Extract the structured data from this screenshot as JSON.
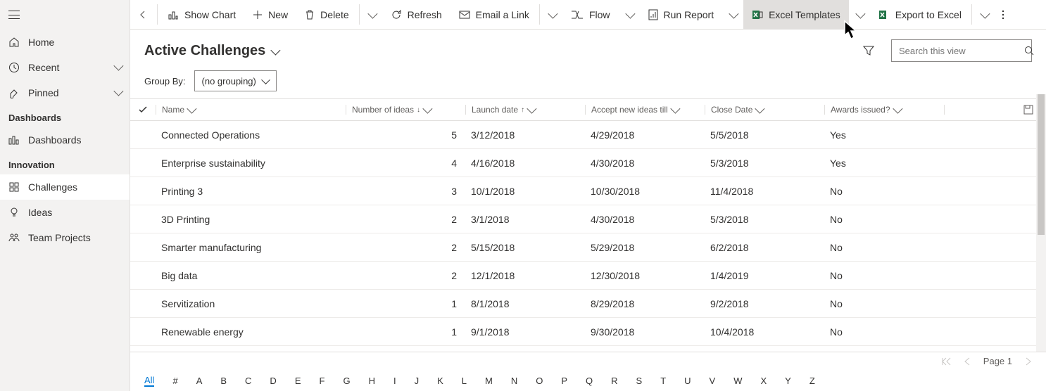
{
  "sidebar": {
    "home": "Home",
    "recent": "Recent",
    "pinned": "Pinned",
    "section_dashboards": "Dashboards",
    "dashboards_item": "Dashboards",
    "section_innovation": "Innovation",
    "challenges": "Challenges",
    "ideas": "Ideas",
    "team_projects": "Team Projects"
  },
  "toolbar": {
    "show_chart": "Show Chart",
    "new": "New",
    "delete": "Delete",
    "refresh": "Refresh",
    "email_link": "Email a Link",
    "flow": "Flow",
    "run_report": "Run Report",
    "excel_templates": "Excel Templates",
    "export_excel": "Export to Excel"
  },
  "view": {
    "title": "Active Challenges",
    "group_by_label": "Group By:",
    "group_by_value": "(no grouping)",
    "search_placeholder": "Search this view"
  },
  "grid": {
    "columns": {
      "name": "Name",
      "number_of_ideas": "Number of ideas",
      "launch_date": "Launch date",
      "accept_until": "Accept new ideas till",
      "close_date": "Close Date",
      "awards_issued": "Awards issued?"
    },
    "rows": [
      {
        "name": "Connected Operations",
        "ideas": "5",
        "launch": "3/12/2018",
        "accept": "4/29/2018",
        "close": "5/5/2018",
        "awards": "Yes"
      },
      {
        "name": "Enterprise sustainability",
        "ideas": "4",
        "launch": "4/16/2018",
        "accept": "4/30/2018",
        "close": "5/3/2018",
        "awards": "Yes"
      },
      {
        "name": "Printing 3",
        "ideas": "3",
        "launch": "10/1/2018",
        "accept": "10/30/2018",
        "close": "11/4/2018",
        "awards": "No"
      },
      {
        "name": "3D Printing",
        "ideas": "2",
        "launch": "3/1/2018",
        "accept": "4/30/2018",
        "close": "5/3/2018",
        "awards": "No"
      },
      {
        "name": "Smarter manufacturing",
        "ideas": "2",
        "launch": "5/15/2018",
        "accept": "5/29/2018",
        "close": "6/2/2018",
        "awards": "No"
      },
      {
        "name": "Big data",
        "ideas": "2",
        "launch": "12/1/2018",
        "accept": "12/30/2018",
        "close": "1/4/2019",
        "awards": "No"
      },
      {
        "name": "Servitization",
        "ideas": "1",
        "launch": "8/1/2018",
        "accept": "8/29/2018",
        "close": "9/2/2018",
        "awards": "No"
      },
      {
        "name": "Renewable energy",
        "ideas": "1",
        "launch": "9/1/2018",
        "accept": "9/30/2018",
        "close": "10/4/2018",
        "awards": "No"
      }
    ]
  },
  "footer": {
    "page_label": "Page 1",
    "alpha": [
      "All",
      "#",
      "A",
      "B",
      "C",
      "D",
      "E",
      "F",
      "G",
      "H",
      "I",
      "J",
      "K",
      "L",
      "M",
      "N",
      "O",
      "P",
      "Q",
      "R",
      "S",
      "T",
      "U",
      "V",
      "W",
      "X",
      "Y",
      "Z"
    ]
  }
}
